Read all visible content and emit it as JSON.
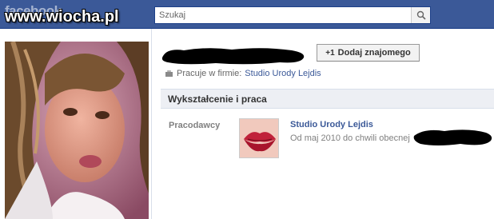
{
  "header": {
    "logo_text": "facebook",
    "watermark_text": "www.wiocha.pl",
    "search_placeholder": "Szukaj",
    "brand_color": "#3b5998"
  },
  "profile": {
    "add_friend_label": "Dodaj znajomego",
    "add_friend_icon": "+1",
    "works_at_prefix": "Pracuje w firmie:",
    "works_at_company": "Studio Urody Lejdis"
  },
  "education_work": {
    "section_title": "Wykształcenie i praca",
    "employers_label": "Pracodawcy",
    "employer": {
      "name": "Studio Urody Lejdis",
      "period": "Od maj 2010 do chwili obecnej"
    }
  },
  "icons": [
    "search-icon",
    "briefcase-icon",
    "add-friend-icon"
  ]
}
